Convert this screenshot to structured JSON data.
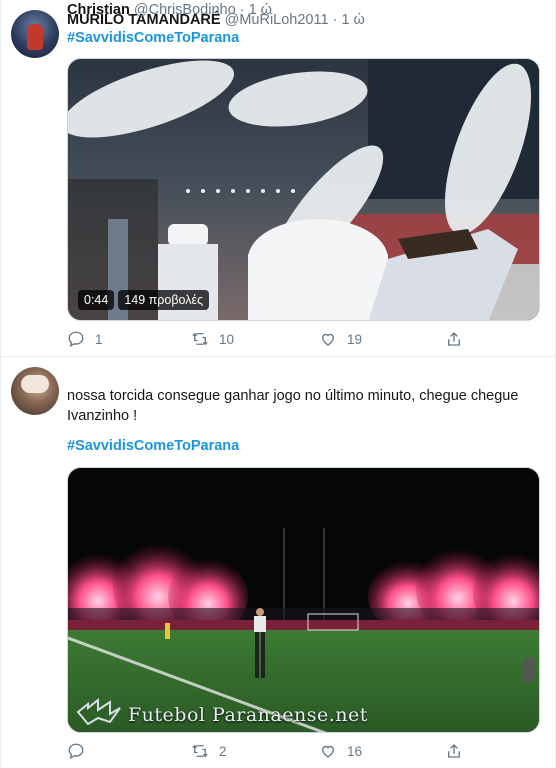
{
  "tweets": [
    {
      "author_name": "MURILO TAMANDARÉ",
      "handle": "@MuRiLoh2011",
      "separator": "·",
      "time": "1 ώ",
      "hashtag": "#SavvidisComeToParana",
      "media": {
        "duration": "0:44",
        "views": "149 προβολές"
      },
      "actions": {
        "replies": "1",
        "retweets": "10",
        "likes": "19"
      }
    },
    {
      "author_name": "Christian",
      "handle": "@ChrisBodinho",
      "separator": "·",
      "time": "1 ώ",
      "text": "nossa torcida consegue ganhar jogo no último minuto, chegue chegue Ivanzinho !",
      "hashtag": "#SavvidisComeToParana",
      "media": {
        "watermark": "Futebol Paranaense.net"
      },
      "actions": {
        "replies": "",
        "retweets": "2",
        "likes": "16"
      }
    }
  ],
  "colors": {
    "link": "#1b95e0",
    "muted": "#657786",
    "text": "#14171a",
    "flares": "#ff3d7f"
  },
  "icons": [
    "reply-icon",
    "retweet-icon",
    "like-icon",
    "share-icon"
  ]
}
